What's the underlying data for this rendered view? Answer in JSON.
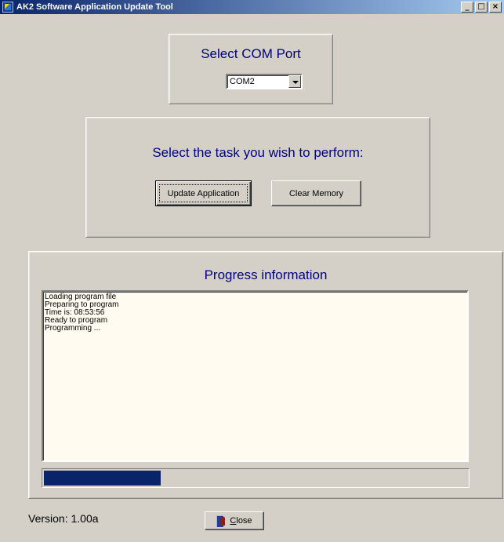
{
  "window": {
    "title": "AK2 Software Application Update Tool",
    "minimize": "_",
    "maximize": "□",
    "close": "×"
  },
  "com_port": {
    "heading": "Select COM Port",
    "selected": "COM2"
  },
  "task": {
    "heading": "Select the task you wish to perform:",
    "update_label": "Update Application",
    "clear_label": "Clear Memory"
  },
  "progress": {
    "heading": "Progress information",
    "log": [
      "Loading program file",
      "Preparing to program",
      "Time is: 08:53:56",
      "Ready to program",
      "Programming ..."
    ],
    "fraction": 0.275,
    "fill_color": "#0a246a"
  },
  "footer": {
    "version": "Version: 1.00a",
    "close_label": "Close"
  },
  "colors": {
    "heading": "#000080",
    "titlebar": "#0a246a",
    "background": "#d4d0c8",
    "log_background": "#fffbf0"
  }
}
